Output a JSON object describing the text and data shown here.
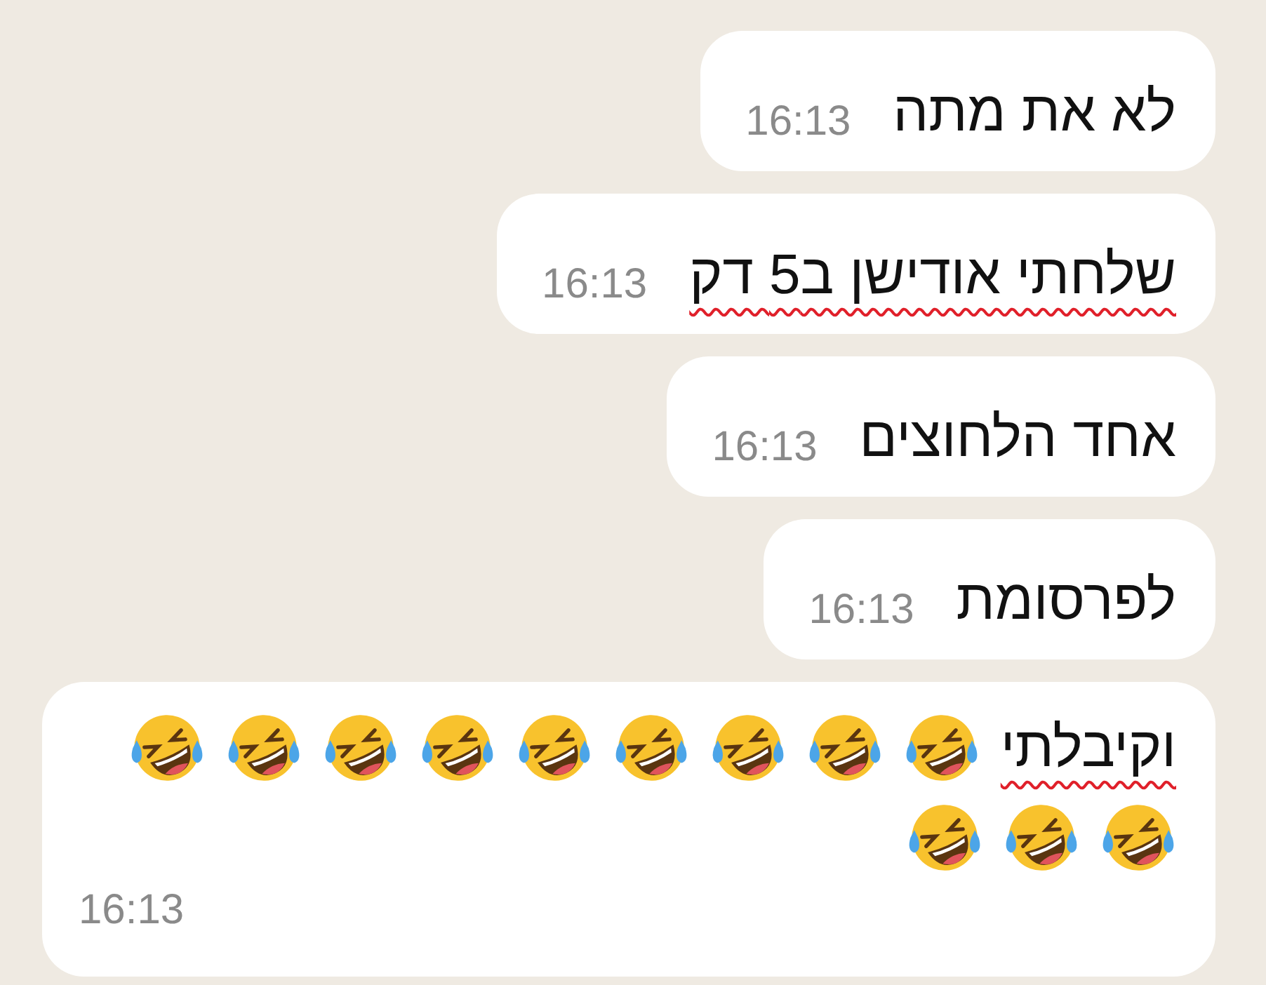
{
  "messages": [
    {
      "text": "לא את מתה",
      "time": "16:13",
      "misspelled": false
    },
    {
      "text": "שלחתי אודישן ב5 דק",
      "time": "16:13",
      "misspelled": true
    },
    {
      "text": "אחד הלחוצים",
      "time": "16:13",
      "misspelled": false
    },
    {
      "text": "לפרסומת",
      "time": "16:13",
      "misspelled": false
    },
    {
      "text": "וקיבלתי",
      "time": "16:13",
      "misspelled": true,
      "emojis": [
        {
          "kind": "rofl"
        },
        {
          "kind": "rofl"
        },
        {
          "kind": "rofl"
        },
        {
          "kind": "rofl"
        },
        {
          "kind": "rofl"
        },
        {
          "kind": "rofl"
        },
        {
          "kind": "rofl"
        },
        {
          "kind": "rofl"
        },
        {
          "kind": "rofl"
        },
        {
          "kind": "rofl"
        },
        {
          "kind": "rofl"
        },
        {
          "kind": "rofl"
        }
      ]
    }
  ]
}
